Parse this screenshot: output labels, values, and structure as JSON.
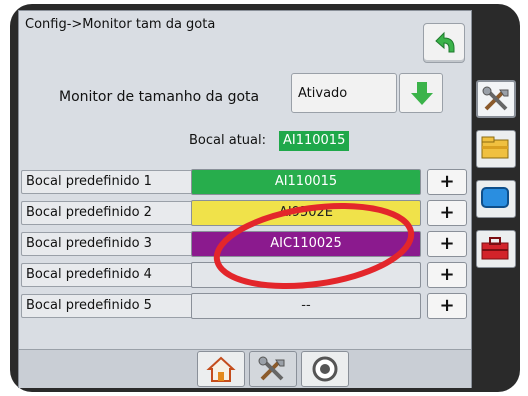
{
  "header": {
    "title": "Config->Monitor tam da gota"
  },
  "monitor": {
    "label": "Monitor de tamanho da gota",
    "value": "Ativado"
  },
  "current_nozzle": {
    "label": "Bocal atual:",
    "value": "AI110015"
  },
  "presets": [
    {
      "label": "Bocal predefinido 1",
      "value": "AI110015",
      "color": "#27ad4c",
      "text_color": "#ffffff"
    },
    {
      "label": "Bocal predefinido 2",
      "value": "AI9502E",
      "color": "#f0e24a",
      "text_color": "#222222"
    },
    {
      "label": "Bocal predefinido 3",
      "value": "AIC110025",
      "color": "#8b1a8e",
      "text_color": "#ffffff"
    },
    {
      "label": "Bocal predefinido 4",
      "value": "",
      "color": "#e3e6ea",
      "text_color": "#222222"
    },
    {
      "label": "Bocal predefinido 5",
      "value": "--",
      "color": "#e3e6ea",
      "text_color": "#222222"
    }
  ],
  "plus_label": "+",
  "icons": {
    "back": "back-arrow-icon",
    "dropdown": "green-down-arrow-icon",
    "nav": [
      "home-icon",
      "tools-icon",
      "gauge-icon"
    ],
    "side": [
      "tools-icon",
      "folder-icon",
      "monitor-icon",
      "toolbox-icon"
    ]
  },
  "colors": {
    "annotation": "#e3262b",
    "accent_green": "#1fa84a"
  }
}
